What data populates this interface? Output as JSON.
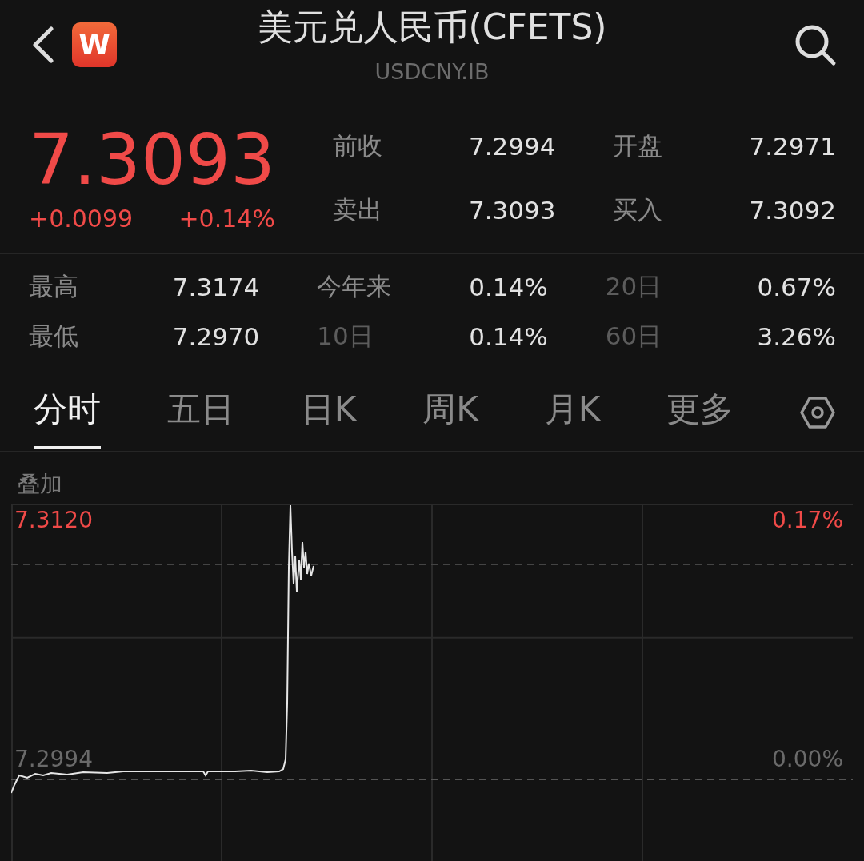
{
  "header": {
    "title": "美元兑人民币(CFETS)",
    "symbol": "USDCNY.IB",
    "logo": "W"
  },
  "quote": {
    "price": "7.3093",
    "change": "+0.0099",
    "change_percent": "+0.14%",
    "up": true,
    "stats": [
      {
        "label": "前收",
        "value": "7.2994",
        "dim": false
      },
      {
        "label": "开盘",
        "value": "7.2971",
        "dim": false
      },
      {
        "label": "卖出",
        "value": "7.3093",
        "dim": false
      },
      {
        "label": "买入",
        "value": "7.3092",
        "dim": false
      }
    ]
  },
  "summary": [
    {
      "label": "最高",
      "value": "7.3174",
      "dim": false
    },
    {
      "label": "今年来",
      "value": "0.14%",
      "dim": false
    },
    {
      "label": "20日",
      "value": "0.67%",
      "dim": true
    },
    {
      "label": "最低",
      "value": "7.2970",
      "dim": false
    },
    {
      "label": "10日",
      "value": "0.14%",
      "dim": true
    },
    {
      "label": "60日",
      "value": "3.26%",
      "dim": true
    }
  ],
  "tabs": [
    {
      "label": "分时",
      "selected": true
    },
    {
      "label": "五日",
      "selected": false
    },
    {
      "label": "日K",
      "selected": false
    },
    {
      "label": "周K",
      "selected": false
    },
    {
      "label": "月K",
      "selected": false
    },
    {
      "label": "更多",
      "selected": false
    }
  ],
  "overlay_label": "叠加",
  "chart": {
    "axis_labels": [
      {
        "price": "7.3120",
        "percent": "0.17%",
        "up": true
      },
      {
        "price": "7.2994",
        "percent": "0.00%",
        "up": false
      }
    ]
  }
}
